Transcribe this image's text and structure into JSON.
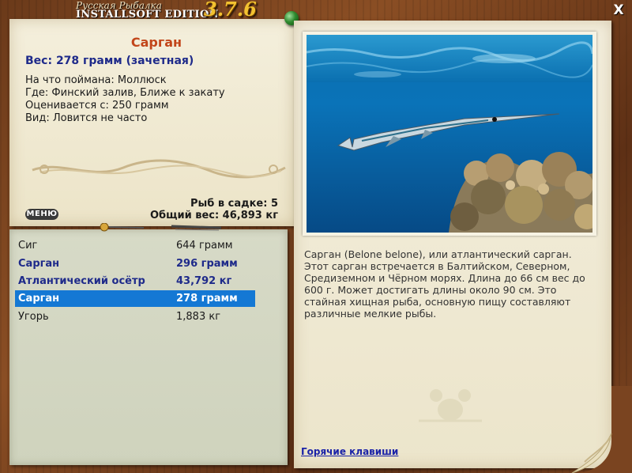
{
  "brand": {
    "top": "Русская Рыбалка",
    "main": "INSTALLSOFT EDITION",
    "version": "3.7.6"
  },
  "close_glyph": "X",
  "fish": {
    "name": "Сарган",
    "weight": "Вес: 278 грамм (зачетная)",
    "info": [
      "На что поймана: Моллюск",
      "Где: Финский залив, Ближе к закату",
      "Оценивается с: 250 грамм",
      "Вид: Ловится не часто"
    ]
  },
  "keepnet": {
    "count": "Рыб в садке: 5",
    "total": "Общий вес: 46,893 кг"
  },
  "menu_label": "МЕНЮ",
  "catch_list": [
    {
      "name": "Сиг",
      "weight": "644 грамм",
      "style": "normal"
    },
    {
      "name": "Сарган",
      "weight": "296 грамм",
      "style": "bold"
    },
    {
      "name": "Атлантический осётр",
      "weight": "43,792 кг",
      "style": "bold"
    },
    {
      "name": "Сарган",
      "weight": "278 грамм",
      "style": "selected"
    },
    {
      "name": "Угорь",
      "weight": "1,883 кг",
      "style": "normal"
    }
  ],
  "description": "Сарган (Belone belone), или атлантический сарган. Этот сарган встречается в Балтийском, Северном, Средиземном и Чёрном морях. Длина до 66 см вес до 600 г. Может достигать длины около 90 см. Это стайная хищная рыба, основную пищу составляют различные мелкие рыбы.",
  "hotkeys_label": "Горячие клавиши",
  "icons": {
    "close": "close-icon",
    "pin": "pin-icon",
    "rod": "fishing-rod-icon"
  },
  "colors": {
    "title_orange": "#c2461a",
    "accent_blue": "#1e2a8a",
    "selection": "#1478d4",
    "version_gold": "#f2c230"
  }
}
